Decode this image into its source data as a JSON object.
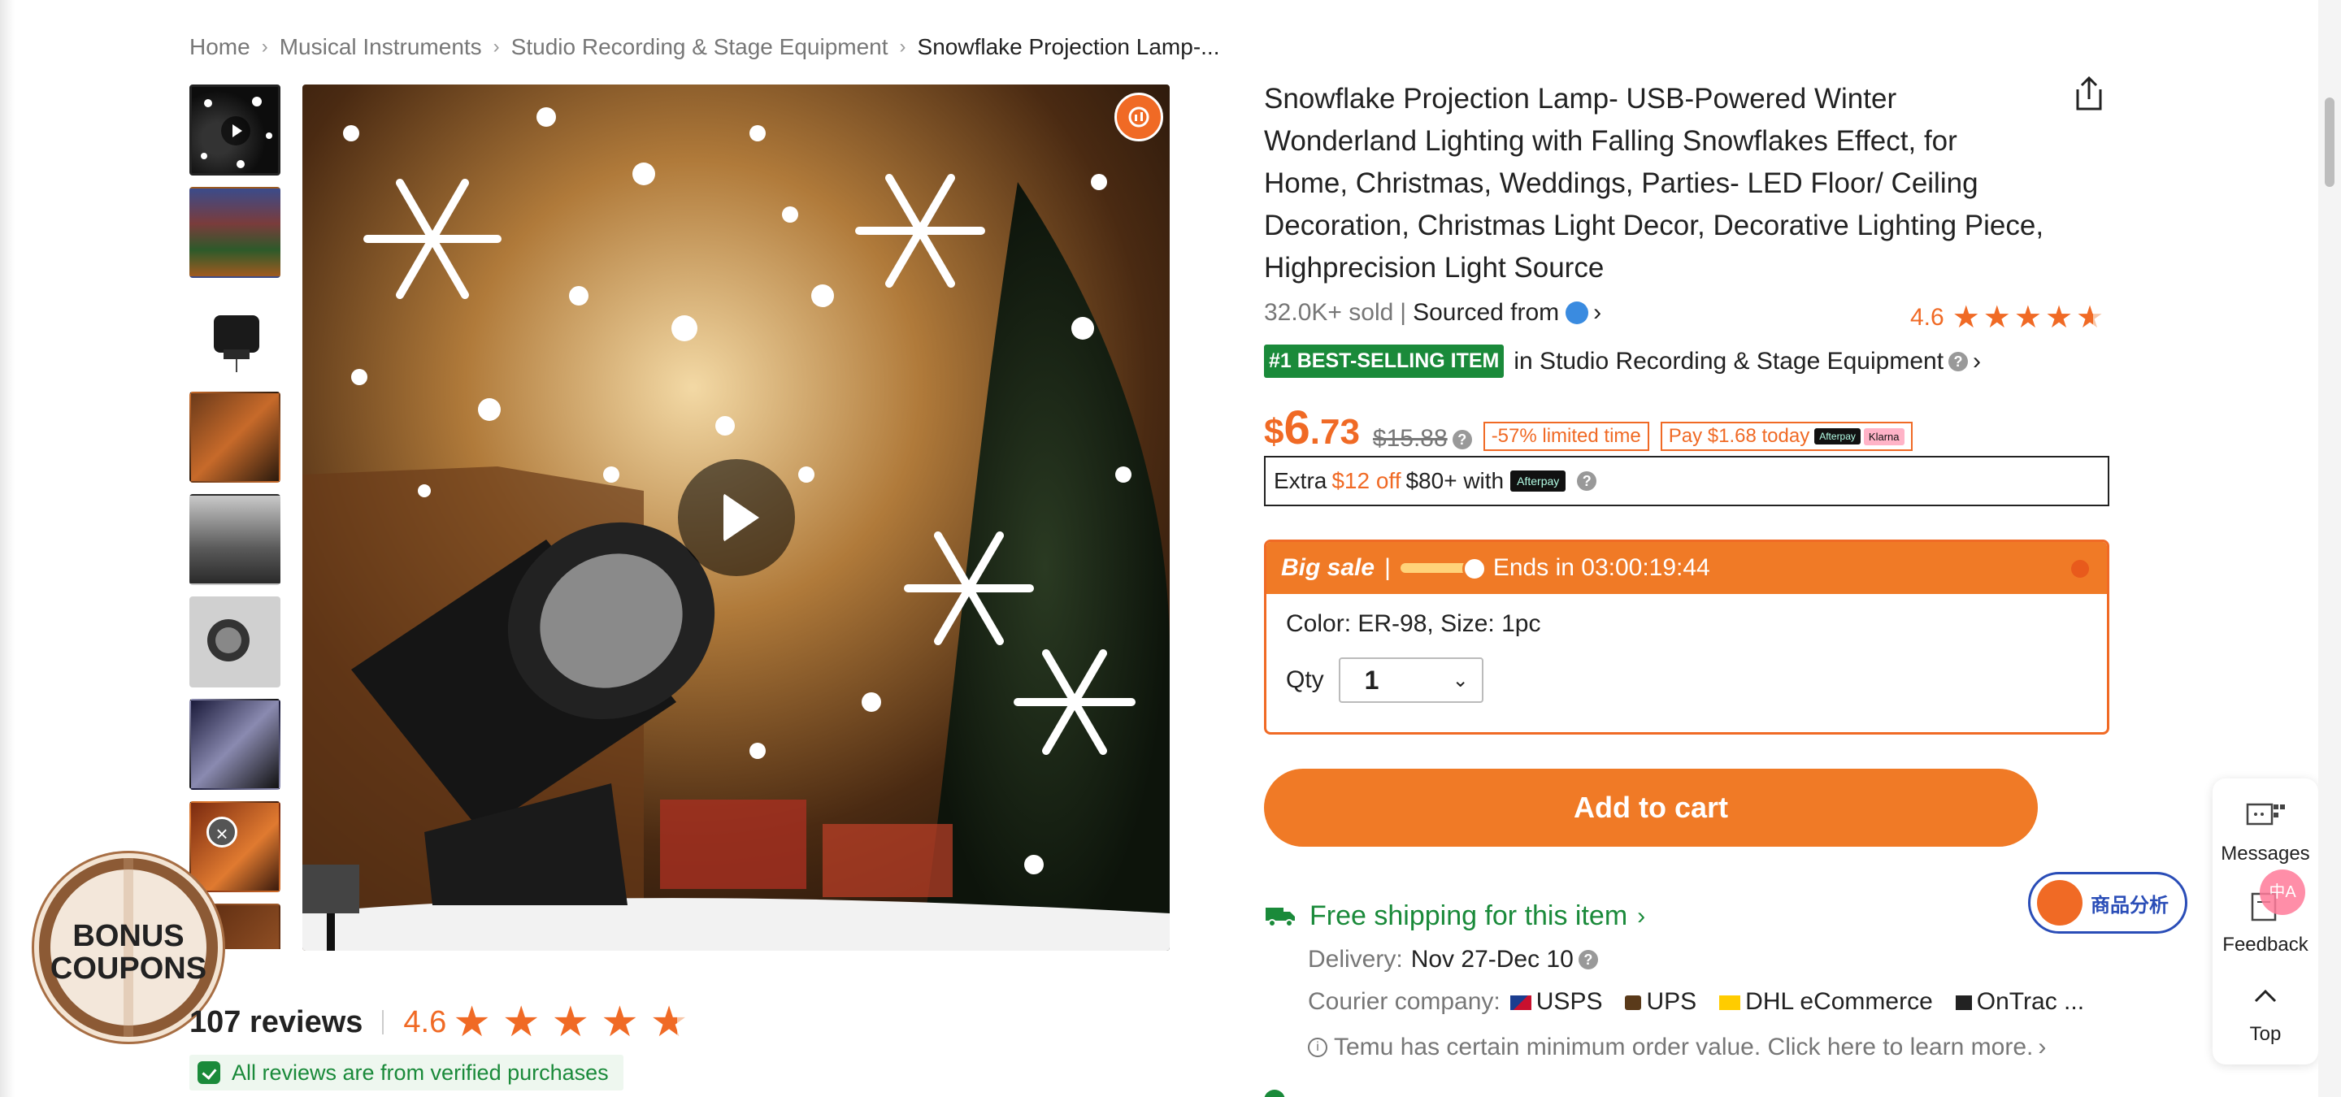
{
  "breadcrumb": {
    "items": [
      "Home",
      "Musical Instruments",
      "Studio Recording & Stage Equipment"
    ],
    "current": "Snowflake Projection Lamp-..."
  },
  "product": {
    "title": "Snowflake Projection Lamp- USB-Powered Winter Wonderland Lighting with Falling Snowflakes Effect, for Home, Christmas, Weddings, Parties- LED Floor/ Ceiling Decoration, Christmas Light Decor, Decorative Lighting Piece, Highprecision Light Source",
    "sold": "32.0K+ sold",
    "separator": "|",
    "sourced": "Sourced from",
    "rating": "4.6",
    "best_badge": "#1 BEST-SELLING ITEM",
    "best_text": "in Studio Recording & Stage Equipment",
    "price_currency": "$",
    "price_whole": "6",
    "price_cents": ".73",
    "old_price": "$15.88",
    "limited": "-57% limited time",
    "pay_today": "Pay $1.68 today",
    "afterpay": "Afterpay",
    "klarna": "Klarna"
  },
  "extra": {
    "prefix": "Extra",
    "off": "$12 off",
    "suffix": "$80+ with",
    "logo": "Afterpay"
  },
  "sale": {
    "label": "Big sale",
    "pipe": "|",
    "ends": "Ends in 03:00:19:44",
    "variant": "Color: ER-98, Size: 1pc",
    "qty_label": "Qty",
    "qty_value": "1"
  },
  "cart": {
    "label": "Add to cart"
  },
  "shipping": {
    "title": "Free shipping for this item",
    "delivery_label": "Delivery:",
    "delivery_value": "Nov 27-Dec 10",
    "courier_label": "Courier company:",
    "couriers": [
      "USPS",
      "UPS",
      "DHL eCommerce",
      "OnTrac ..."
    ],
    "notice": "Temu has certain minimum order value. Click here to learn more."
  },
  "reviews": {
    "count": "107 reviews",
    "rating": "4.6",
    "verified": "All reviews are from verified purchases"
  },
  "bonus": {
    "line1": "BONUS",
    "line2": "COUPONS"
  },
  "widgets": {
    "shangpin": "商品分析",
    "messages": "Messages",
    "feedback": "Feedback",
    "top": "Top",
    "translate": "中A"
  },
  "icons": {
    "share": "share-icon",
    "play": "play-icon",
    "truck": "truck-icon",
    "star": "star-icon",
    "chevron": "chevron-right-icon"
  },
  "colors": {
    "accent": "#f06a25",
    "green": "#1a8a3a",
    "analysis_blue": "#2a4db7"
  }
}
